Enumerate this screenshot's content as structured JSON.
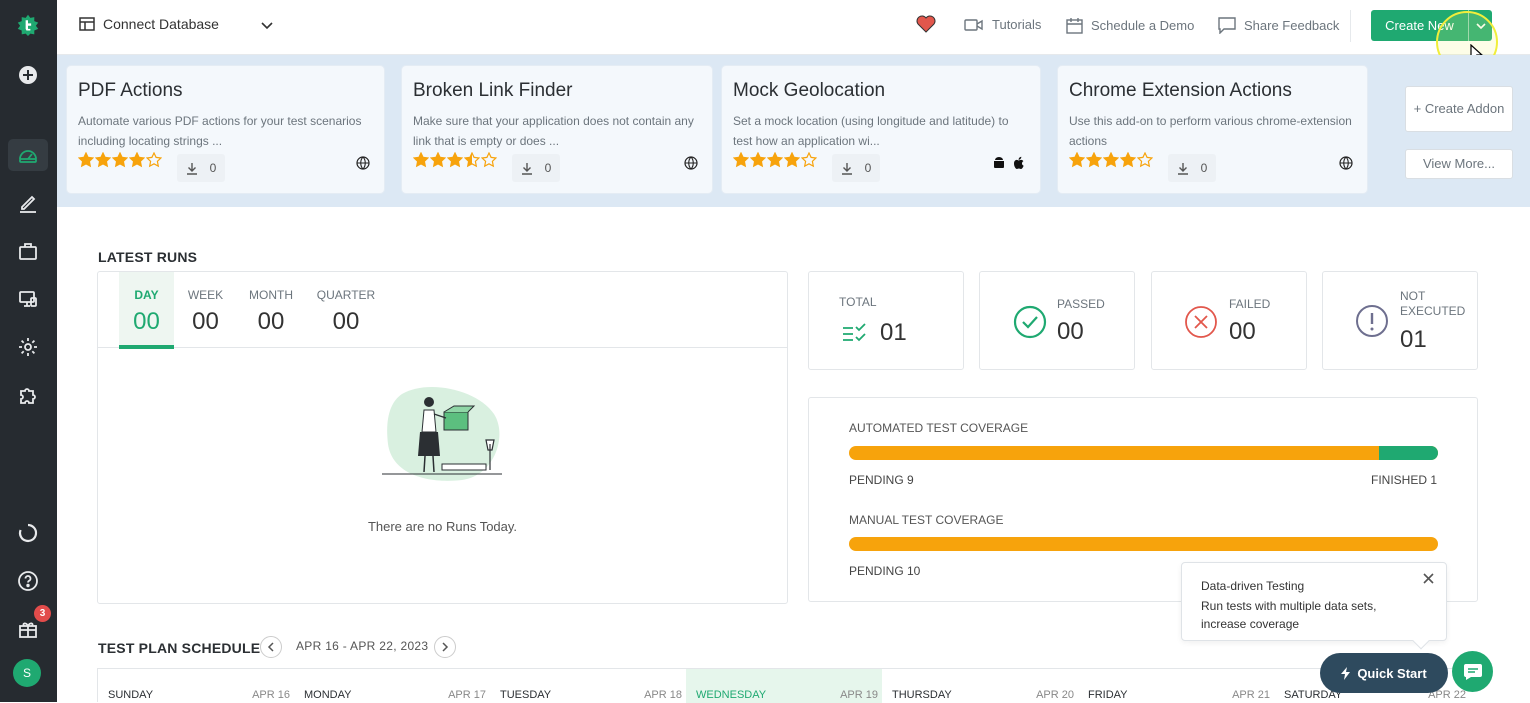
{
  "topbar": {
    "connect_label": "Connect Database",
    "tutorials": "Tutorials",
    "schedule_demo": "Schedule a Demo",
    "share_feedback": "Share Feedback",
    "create_new": "Create New"
  },
  "addons": [
    {
      "title": "PDF Actions",
      "desc": "Automate various PDF actions for your test scenarios including locating strings ...",
      "rating": 4,
      "downloads": "0",
      "platforms": [
        "globe-icon"
      ]
    },
    {
      "title": "Broken Link Finder",
      "desc": "Make sure that your application does not contain any link that is empty or does ...",
      "rating": 3.5,
      "downloads": "0",
      "platforms": [
        "globe-icon"
      ]
    },
    {
      "title": "Mock Geolocation",
      "desc": "Set a mock location (using longitude and latitude) to test how an application wi...",
      "rating": 4,
      "downloads": "0",
      "platforms": [
        "android-icon",
        "apple-icon"
      ]
    },
    {
      "title": "Chrome Extension Actions",
      "desc": "Use this add-on to perform various chrome-extension actions",
      "rating": 4,
      "downloads": "0",
      "platforms": [
        "globe-icon"
      ]
    }
  ],
  "addon_buttons": {
    "create": "+ Create Addon",
    "view_more": "View More..."
  },
  "latest_runs": {
    "title": "LATEST RUNS",
    "tabs": [
      {
        "label": "DAY",
        "value": "00"
      },
      {
        "label": "WEEK",
        "value": "00"
      },
      {
        "label": "MONTH",
        "value": "00"
      },
      {
        "label": "QUARTER",
        "value": "00"
      }
    ],
    "empty_message": "There are no Runs Today."
  },
  "stats": {
    "total": {
      "label": "TOTAL",
      "value": "01"
    },
    "passed": {
      "label": "PASSED",
      "value": "00"
    },
    "failed": {
      "label": "FAILED",
      "value": "00"
    },
    "not_executed": {
      "label": "NOT EXECUTED",
      "value": "01"
    }
  },
  "coverage": {
    "automated": {
      "label": "AUTOMATED TEST COVERAGE",
      "pending": "PENDING 9",
      "finished": "FINISHED 1",
      "finished_fraction": 0.1
    },
    "manual": {
      "label": "MANUAL TEST COVERAGE",
      "pending": "PENDING 10",
      "finished_fraction": 0
    }
  },
  "toast": {
    "title": "Data-driven Testing",
    "body": "Run tests with multiple data sets, increase coverage"
  },
  "quick_start": "Quick Start",
  "schedule": {
    "title": "TEST PLAN SCHEDULE",
    "range": "APR 16 - APR 22, 2023",
    "days": [
      {
        "name": "SUNDAY",
        "date": "APR 16"
      },
      {
        "name": "MONDAY",
        "date": "APR 17"
      },
      {
        "name": "TUESDAY",
        "date": "APR 18"
      },
      {
        "name": "WEDNESDAY",
        "date": "APR 19"
      },
      {
        "name": "THURSDAY",
        "date": "APR 20"
      },
      {
        "name": "FRIDAY",
        "date": "APR 21"
      },
      {
        "name": "SATURDAY",
        "date": "APR 22"
      }
    ]
  },
  "sidebar": {
    "notification_count": "3",
    "avatar_initial": "S"
  },
  "colors": {
    "brand": "#1fa971",
    "pending": "#f7a30c",
    "sidebar": "#262b30",
    "failed": "#e2574c"
  }
}
